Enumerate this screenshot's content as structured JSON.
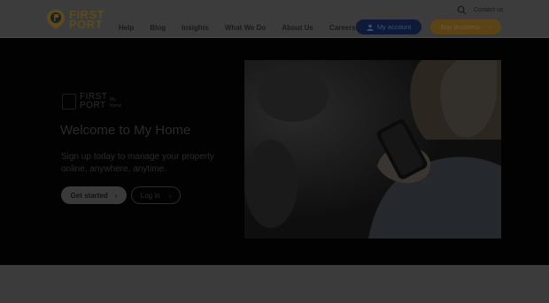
{
  "brand": {
    "line1": "FIRST",
    "line2": "PORT"
  },
  "nav": {
    "items": [
      "Help",
      "Blog",
      "Insights",
      "What We Do",
      "About Us",
      "Careers"
    ]
  },
  "topbar": {
    "contact_label": "Contact us",
    "account_label": "My account",
    "business_label": "Buy business"
  },
  "hero": {
    "logo_line1": "FIRST",
    "logo_line2": "PORT",
    "logo_sub1": "My",
    "logo_sub2": "Home",
    "title": "Welcome to My Home",
    "subtitle": "Sign up today to manage your property online, anywhere, anytime.",
    "cta_primary": "Get started",
    "cta_secondary": "Log in"
  },
  "colors": {
    "account_button": "#0e1a38",
    "business_button": "#5a4416",
    "hero_background": "#020202"
  },
  "icons": [
    "search-icon",
    "user-icon",
    "chevron-right-icon"
  ]
}
